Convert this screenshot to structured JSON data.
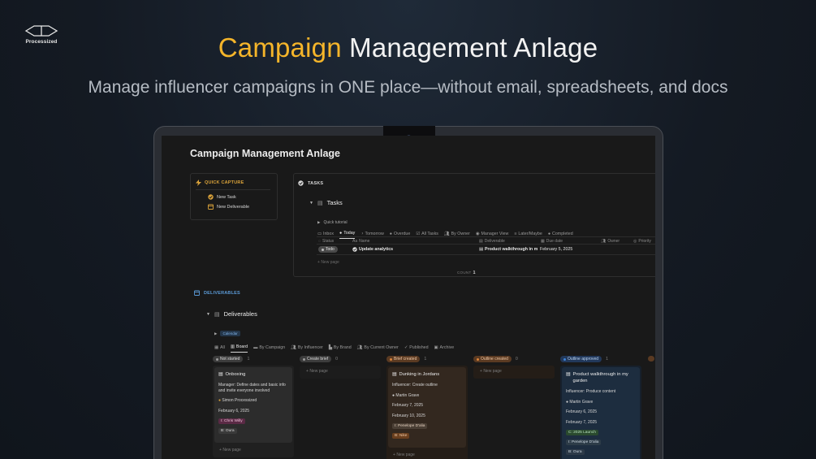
{
  "brand": {
    "name": "Processized"
  },
  "hero": {
    "title_accent": "Campaign",
    "title_rest": "Management Anlage",
    "subtitle": "Manage influencer campaigns in ONE place—without email, spreadsheets, and docs"
  },
  "app": {
    "title": "Campaign Management Anlage",
    "quick_capture": {
      "label": "QUICK CAPTURE",
      "items": [
        "New Task",
        "New Deliverable"
      ]
    },
    "tasks": {
      "section_label": "TASKS",
      "db_title": "Tasks",
      "quick_tutorial": "Quick tutorial",
      "views": [
        "Inbox",
        "Today",
        "Tomorrow",
        "Overdue",
        "All Tasks",
        "By Owner",
        "Manager View",
        "Later/Maybe",
        "Completed"
      ],
      "active_view": "Today",
      "columns": [
        "Status",
        "Name",
        "Deliverable",
        "Due date",
        "Owner",
        "Priority"
      ],
      "rows": [
        {
          "status": "Todo",
          "name": "Update analytics",
          "deliverable": "Product walkthrough in m",
          "due_date": "February 5, 2025"
        }
      ],
      "new_page": "New page",
      "count_label": "COUNT",
      "count_value": "1"
    },
    "deliverables": {
      "section_label": "DELIVERABLES",
      "db_title": "Deliverables",
      "calendar_chip": "Calendar",
      "views": [
        "All",
        "Board",
        "By Campaign",
        "By Influencer",
        "By Brand",
        "By Current Owner",
        "Published",
        "Archive"
      ],
      "active_view": "Board",
      "new_page": "New page",
      "columns": [
        {
          "name": "Not started",
          "count": "1",
          "cards": [
            {
              "title": "Onboxing",
              "line1": "Manager: Define dates and basic info and invite everyone involved",
              "person": "Simon Processized",
              "date1": "February 6, 2025",
              "tag1": "I: Chris Willy",
              "tag2": "B: Oura"
            }
          ]
        },
        {
          "name": "Create brief",
          "count": "0",
          "cards": []
        },
        {
          "name": "Brief created",
          "count": "1",
          "cards": [
            {
              "title": "Dunking in Jordans",
              "line1": "Influencer: Create outline",
              "person": "Martin Grave",
              "date1": "February 7, 2025",
              "date2": "February 10, 2025",
              "tag1": "I: Penelope D'alia",
              "tag2": "B: Nike"
            }
          ]
        },
        {
          "name": "Outline created",
          "count": "0",
          "cards": []
        },
        {
          "name": "Outline approved",
          "count": "1",
          "cards": [
            {
              "title": "Product walkthrough in my garden",
              "line1": "Influencer: Produce content",
              "person": "Martin Grave",
              "date1": "February 6, 2025",
              "date2": "February 7, 2025",
              "tag0": "C: 2025 Launch",
              "tag1": "I: Penelope D'alia",
              "tag2": "B: Oura"
            }
          ]
        }
      ]
    }
  },
  "colors": {
    "accent": "#f5b52a",
    "deliverables_blue": "#5b9ad6",
    "brief_orange": "#d9833a",
    "approved_blue": "#3d82d6"
  }
}
